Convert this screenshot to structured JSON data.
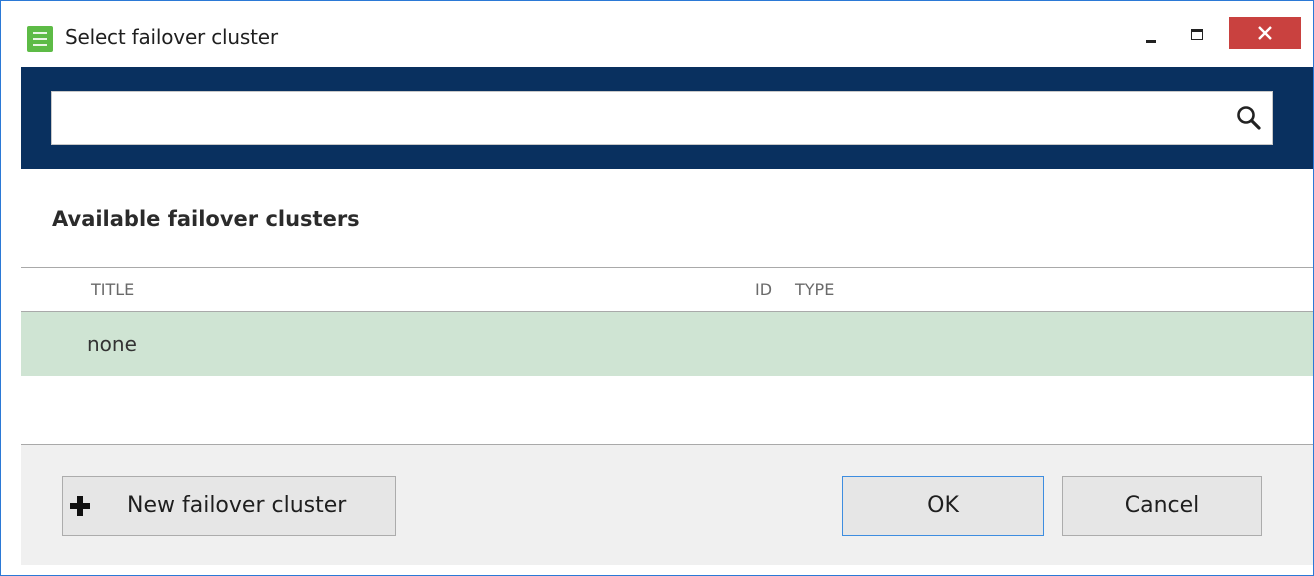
{
  "window": {
    "title": "Select failover cluster",
    "icon": "list-app-icon",
    "controls": [
      "minimize-icon",
      "maximize-icon",
      "close-icon"
    ]
  },
  "search": {
    "value": "",
    "placeholder": "",
    "icon": "search-icon"
  },
  "section": {
    "title": "Available failover clusters"
  },
  "table": {
    "columns": [
      "TITLE",
      "ID",
      "TYPE"
    ],
    "rows": [
      {
        "title": "none",
        "id": "",
        "type": "",
        "selected": true
      }
    ]
  },
  "footer": {
    "new_label": "New failover cluster",
    "ok_label": "OK",
    "cancel_label": "Cancel"
  },
  "colors": {
    "search_band": "#09305f",
    "selected_row": "#cfe4d3",
    "close_button": "#c9413f",
    "window_border": "#2b79d6",
    "app_icon": "#5dbb46"
  }
}
